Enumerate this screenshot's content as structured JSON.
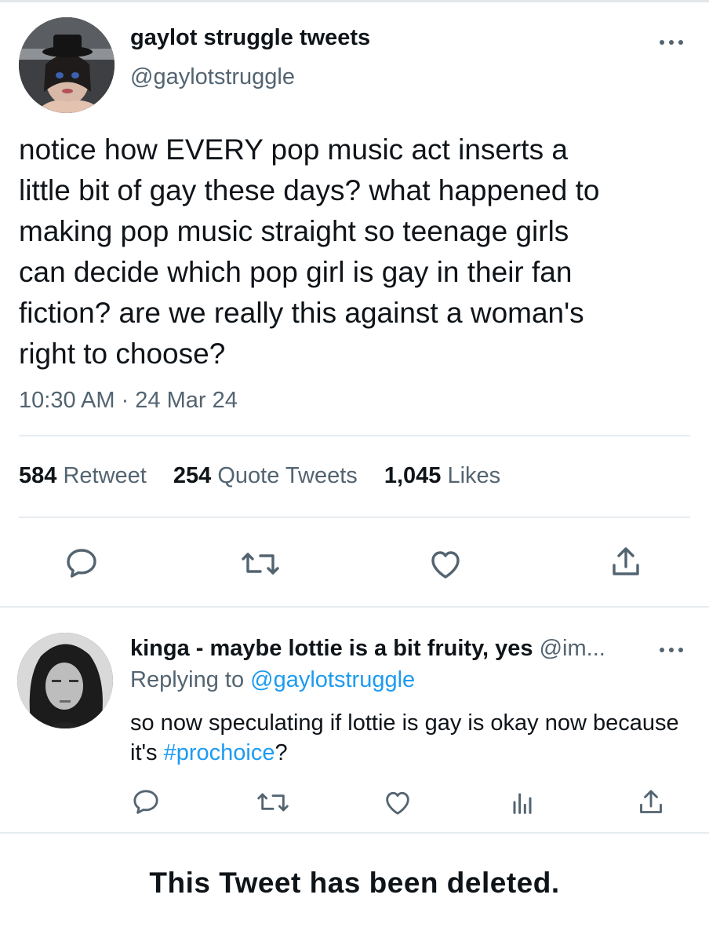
{
  "main_tweet": {
    "author_name": "gaylot struggle tweets",
    "author_handle": "@gaylotstruggle",
    "text": "notice how EVERY pop music act inserts a\nlittle bit of gay these days? what happened to\nmaking pop music straight so teenage girls\ncan decide which pop girl is gay in their fan\nfiction? are we really this against a woman's\nright to choose?",
    "timestamp": "10:30 AM · 24 Mar 24",
    "stats": {
      "retweets": {
        "count": "584",
        "label": "Retweet"
      },
      "quotes": {
        "count": "254",
        "label": "Quote Tweets"
      },
      "likes": {
        "count": "1,045",
        "label": "Likes"
      }
    },
    "actions": [
      "reply-icon",
      "retweet-icon",
      "like-icon",
      "share-icon"
    ]
  },
  "reply_tweet": {
    "author_name": "kinga - maybe lottie is a bit fruity, yes",
    "author_handle": "@im...",
    "replying_prefix": "Replying to ",
    "replying_to": "@gaylotstruggle",
    "text_before": "so now speculating if lottie is gay is okay now because it's ",
    "hashtag": "#prochoice",
    "text_after": "?",
    "actions": [
      "reply-icon",
      "retweet-icon",
      "like-icon",
      "analytics-icon",
      "share-icon"
    ]
  },
  "footer_notice": "This Tweet has been deleted.",
  "colors": {
    "text": "#0f1419",
    "secondary": "#536471",
    "link": "#1d9bf0",
    "divider": "#e6ecf0"
  }
}
